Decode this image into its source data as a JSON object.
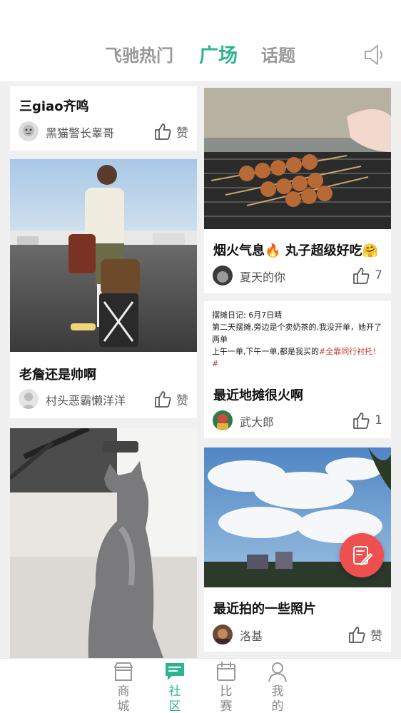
{
  "header": {
    "tabs": [
      {
        "label": "飞驰热门"
      },
      {
        "label": "广场"
      },
      {
        "label": "话题"
      }
    ]
  },
  "posts": {
    "p1": {
      "title": "三giao齐鸣",
      "author": "黑猫警长睾哥",
      "like": "赞"
    },
    "p2": {
      "title": "老詹还是帅啊",
      "author": "村头恶霸懒洋洋",
      "like": "赞"
    },
    "p4": {
      "title": "烟火气息🔥 丸子超级好吃🤗",
      "author": "夏天的你",
      "like": "7"
    },
    "p5": {
      "text_line1": "摆摊日记: 6月7日晴",
      "text_line2": "第二天摆摊,旁边是个卖奶茶的,我没开单，她开了两单",
      "text_line3_a": "上午一单,下午一单,都是我买的",
      "text_line3_b": "#全靠同行衬托！#",
      "title": "最近地摊很火啊",
      "author": "武大郎",
      "like": "1"
    },
    "p6": {
      "title": "最近拍的一些照片",
      "author": "洛基",
      "like": "赞"
    }
  },
  "bottom_nav": [
    {
      "label": "商城"
    },
    {
      "label": "社区"
    },
    {
      "label": "比赛"
    },
    {
      "label": "我的"
    }
  ],
  "colors": {
    "accent": "#2bb58f",
    "fab": "#ee4f4f"
  }
}
